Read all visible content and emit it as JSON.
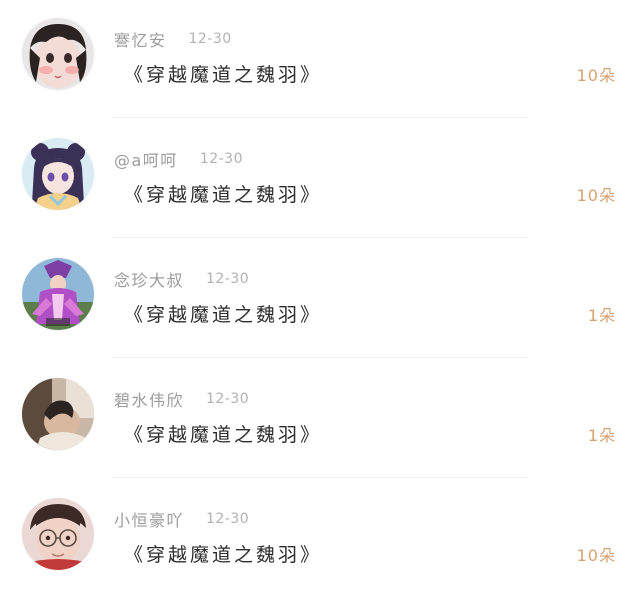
{
  "rows": [
    {
      "name": "謇忆安",
      "time": "12-30",
      "title": "《穿越魔道之魏羽》",
      "count": "10朵",
      "avatar": "avatar-girl-blush"
    },
    {
      "name": "@a呵呵",
      "time": "12-30",
      "title": "《穿越魔道之魏羽》",
      "count": "10朵",
      "avatar": "avatar-anime-girl"
    },
    {
      "name": "念珍大叔",
      "time": "12-30",
      "title": "《穿越魔道之魏羽》",
      "count": "1朵",
      "avatar": "avatar-game-character"
    },
    {
      "name": "碧水伟欣",
      "time": "12-30",
      "title": "《穿越魔道之魏羽》",
      "count": "1朵",
      "avatar": "avatar-photo-person"
    },
    {
      "name": "小恒豪吖",
      "time": "12-30",
      "title": "《穿越魔道之魏羽》",
      "count": "10朵",
      "avatar": "avatar-boy-glasses"
    }
  ],
  "colors": {
    "count": "#d6a171",
    "meta": "#9c9c9c",
    "title": "#2d2d2d",
    "divider": "#f0f0f0"
  }
}
